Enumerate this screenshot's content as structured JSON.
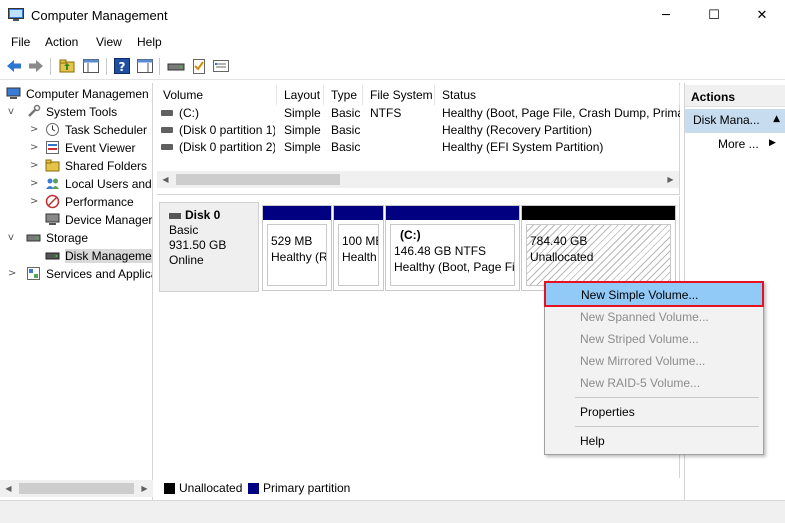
{
  "window": {
    "title": "Computer Management",
    "minimize": "─",
    "maximize": "☐",
    "close": "✕"
  },
  "menu": [
    "File",
    "Action",
    "View",
    "Help"
  ],
  "toolbar": {
    "icons": [
      "back-arrow-icon",
      "forward-arrow-icon",
      "up-folder-icon",
      "show-hide-tree-icon",
      "help-icon",
      "properties-pane-icon",
      "disk-icon",
      "checklist-icon",
      "settings-list-icon"
    ]
  },
  "tree": {
    "items": [
      {
        "label": "Computer Managemen",
        "icon": "computer-icon",
        "expander": ""
      },
      {
        "label": "System Tools",
        "icon": "tools-icon",
        "expander": "v"
      },
      {
        "label": "Task Scheduler",
        "icon": "clock-icon",
        "expander": ">"
      },
      {
        "label": "Event Viewer",
        "icon": "event-viewer-icon",
        "expander": ">"
      },
      {
        "label": "Shared Folders",
        "icon": "shared-folder-icon",
        "expander": ">"
      },
      {
        "label": "Local Users and",
        "icon": "users-icon",
        "expander": ">"
      },
      {
        "label": "Performance",
        "icon": "performance-icon",
        "expander": ">"
      },
      {
        "label": "Device Manager",
        "icon": "device-manager-icon",
        "expander": ""
      },
      {
        "label": "Storage",
        "icon": "storage-icon",
        "expander": "v"
      },
      {
        "label": "Disk Manageme",
        "icon": "disk-icon",
        "expander": ""
      },
      {
        "label": "Services and Applica",
        "icon": "services-icon",
        "expander": ">"
      }
    ]
  },
  "volumes": {
    "columns": [
      "Volume",
      "Layout",
      "Type",
      "File System",
      "Status"
    ],
    "rows": [
      {
        "volume": "(C:)",
        "layout": "Simple",
        "type": "Basic",
        "fs": "NTFS",
        "status": "Healthy (Boot, Page File, Crash Dump, Primai"
      },
      {
        "volume": "(Disk 0 partition 1)",
        "layout": "Simple",
        "type": "Basic",
        "fs": "",
        "status": "Healthy (Recovery Partition)"
      },
      {
        "volume": "(Disk 0 partition 2)",
        "layout": "Simple",
        "type": "Basic",
        "fs": "",
        "status": "Healthy (EFI System Partition)"
      }
    ]
  },
  "disk": {
    "name": "Disk 0",
    "type": "Basic",
    "size": "931.50 GB",
    "state": "Online",
    "partitions": [
      {
        "line1": "529 MB",
        "line2": "Healthy (R",
        "name": ""
      },
      {
        "line1": "100 MB",
        "line2": "Health",
        "name": ""
      },
      {
        "name": "(C:)",
        "line1": "146.48 GB NTFS",
        "line2": "Healthy (Boot, Page Fil"
      },
      {
        "line1": "784.40 GB",
        "line2": "Unallocated",
        "name": ""
      }
    ]
  },
  "legend": {
    "unallocated": "Unallocated",
    "primary": "Primary partition"
  },
  "actions": {
    "header": "Actions",
    "sub": "Disk Mana...",
    "more": "More ..."
  },
  "context_menu": {
    "items": [
      "New Simple Volume...",
      "New Spanned Volume...",
      "New Striped Volume...",
      "New Mirrored Volume...",
      "New RAID-5 Volume...",
      "Properties",
      "Help"
    ]
  },
  "colors": {
    "primary_partition": "#000080",
    "unallocated": "#000000",
    "highlight": "#91c9f7",
    "outline": "#e81123",
    "selection": "#c7dcef"
  }
}
